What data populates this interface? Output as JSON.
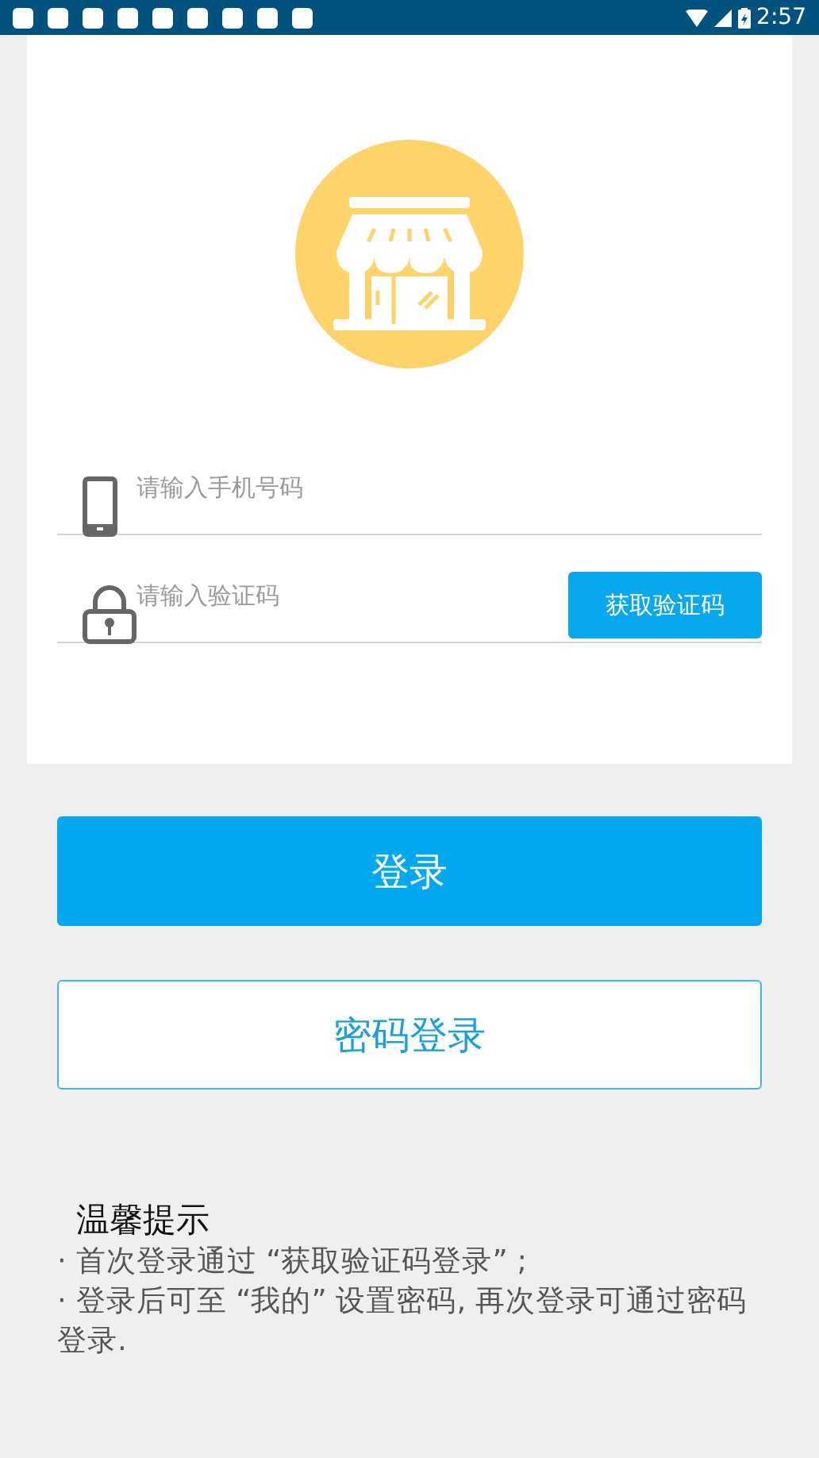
{
  "status_bar": {
    "notifications": [
      {
        "kind": "app"
      },
      {
        "kind": "app"
      },
      {
        "kind": "app"
      },
      {
        "kind": "app"
      },
      {
        "kind": "app"
      },
      {
        "kind": "app"
      },
      {
        "kind": "app"
      },
      {
        "kind": "app"
      },
      {
        "kind": "app"
      }
    ],
    "time": "2:57"
  },
  "login_form": {
    "phone_field": {
      "placeholder": "请输入手机号码"
    },
    "code_field": {
      "placeholder": "请输入验证码"
    },
    "get_code_button": "获取验证码"
  },
  "login_button": "登录",
  "password_login_button": "密码登录",
  "tips": {
    "title": "温馨提示",
    "items": [
      {
        "bullet": "·",
        "text": "首次登录通过 “获取验证码登录” ;"
      },
      {
        "bullet": "·",
        "text": "登录后可至 “我的” 设置密码, 再次登录可通过密码登录."
      }
    ]
  }
}
